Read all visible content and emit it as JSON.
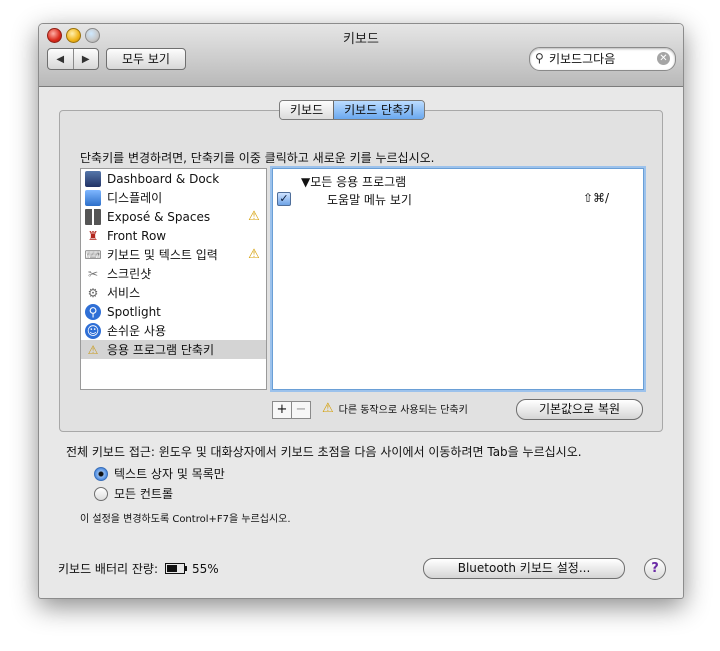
{
  "window": {
    "title": "키보드"
  },
  "toolbar": {
    "back": "◀",
    "forward": "▶",
    "show_all": "모두 보기"
  },
  "search": {
    "value": "키보드그다음",
    "icon": "magnifier-icon",
    "clear_icon": "clear-icon"
  },
  "tabs": [
    {
      "label": "키보드",
      "active": false
    },
    {
      "label": "키보드 단축키",
      "active": true
    }
  ],
  "instructions": "단축키를 변경하려면, 단축키를 이중 클릭하고 새로운 키를 누르십시오.",
  "categories": [
    {
      "label": "Dashboard & Dock",
      "icon": "dashboard-icon",
      "warning": false
    },
    {
      "label": "디스플레이",
      "icon": "display-icon",
      "warning": false
    },
    {
      "label": "Exposé & Spaces",
      "icon": "expose-icon",
      "warning": true
    },
    {
      "label": "Front Row",
      "icon": "front-row-icon",
      "warning": false
    },
    {
      "label": "키보드 및 텍스트 입력",
      "icon": "keyboard-icon",
      "warning": true
    },
    {
      "label": "스크린샷",
      "icon": "screenshot-icon",
      "warning": false
    },
    {
      "label": "서비스",
      "icon": "services-gear-icon",
      "warning": false
    },
    {
      "label": "Spotlight",
      "icon": "spotlight-icon",
      "warning": false
    },
    {
      "label": "손쉬운 사용",
      "icon": "accessibility-icon",
      "warning": false
    },
    {
      "label": "응용 프로그램 단축키",
      "icon": "app-shortcuts-icon",
      "warning": false,
      "selected": true
    }
  ],
  "shortcuts": {
    "group_label": "모든 응용 프로그램",
    "items": [
      {
        "label": "도움말 메뉴 보기",
        "keys": "⇧⌘/",
        "checked": true
      }
    ]
  },
  "list_controls": {
    "add": "+",
    "remove": "−"
  },
  "conflict_note": "다른 동작으로 사용되는 단축키",
  "restore_button": "기본값으로 복원",
  "full_keyboard_access": {
    "label": "전체 키보드 접근: 윈도우 및 대화상자에서 키보드 초점을 다음 사이에서 이동하려면 Tab을 누르십시오.",
    "options": [
      {
        "label": "텍스트 상자 및 목록만",
        "selected": true
      },
      {
        "label": "모든 컨트롤",
        "selected": false
      }
    ],
    "note": "이 설정을 변경하도록 Control+F7을 누르십시오."
  },
  "battery": {
    "label": "키보드 배터리 잔량:",
    "percent_text": "55%",
    "level": 0.55
  },
  "bluetooth_button": "Bluetooth 키보드 설정...",
  "help_button": "?"
}
